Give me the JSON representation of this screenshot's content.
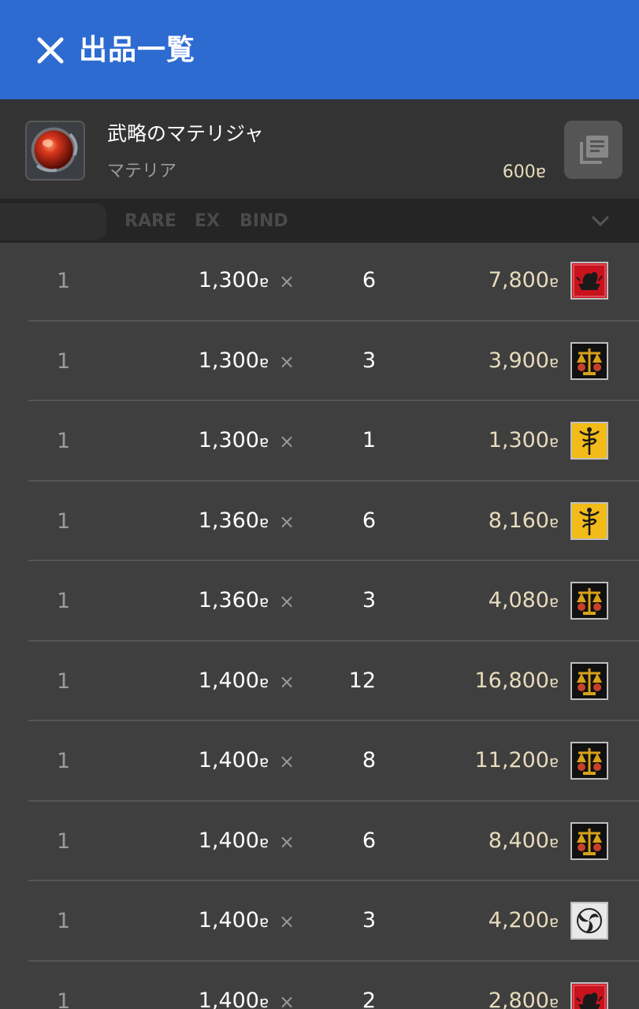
{
  "header": {
    "title": "出品一覧"
  },
  "item": {
    "name": "武略のマテリジャ",
    "category": "マテリア",
    "price": "600ɐ"
  },
  "filters": {
    "rare": "RARE",
    "ex": "EX",
    "bind": "BIND"
  },
  "listings": [
    {
      "hq": "1",
      "unit_price": "1,300",
      "times": "×",
      "quantity": "6",
      "total": "7,800",
      "currency": "ɐ",
      "retainer_icon": "red-bird-crest-icon"
    },
    {
      "hq": "1",
      "unit_price": "1,300",
      "times": "×",
      "quantity": "3",
      "total": "3,900",
      "currency": "ɐ",
      "retainer_icon": "gold-scales-crest-icon"
    },
    {
      "hq": "1",
      "unit_price": "1,300",
      "times": "×",
      "quantity": "1",
      "total": "1,300",
      "currency": "ɐ",
      "retainer_icon": "yellow-caduceus-crest-icon"
    },
    {
      "hq": "1",
      "unit_price": "1,360",
      "times": "×",
      "quantity": "6",
      "total": "8,160",
      "currency": "ɐ",
      "retainer_icon": "yellow-caduceus-crest-icon"
    },
    {
      "hq": "1",
      "unit_price": "1,360",
      "times": "×",
      "quantity": "3",
      "total": "4,080",
      "currency": "ɐ",
      "retainer_icon": "gold-scales-crest-icon"
    },
    {
      "hq": "1",
      "unit_price": "1,400",
      "times": "×",
      "quantity": "12",
      "total": "16,800",
      "currency": "ɐ",
      "retainer_icon": "gold-scales-crest-icon"
    },
    {
      "hq": "1",
      "unit_price": "1,400",
      "times": "×",
      "quantity": "8",
      "total": "11,200",
      "currency": "ɐ",
      "retainer_icon": "gold-scales-crest-icon"
    },
    {
      "hq": "1",
      "unit_price": "1,400",
      "times": "×",
      "quantity": "6",
      "total": "8,400",
      "currency": "ɐ",
      "retainer_icon": "gold-scales-crest-icon"
    },
    {
      "hq": "1",
      "unit_price": "1,400",
      "times": "×",
      "quantity": "3",
      "total": "4,200",
      "currency": "ɐ",
      "retainer_icon": "white-triskele-crest-icon"
    },
    {
      "hq": "1",
      "unit_price": "1,400",
      "times": "×",
      "quantity": "2",
      "total": "2,800",
      "currency": "ɐ",
      "retainer_icon": "red-bird-crest-icon"
    }
  ],
  "colors": {
    "topbar": "#2d6bd0",
    "background": "#3f3f3f",
    "total_text": "#e7dcbc"
  }
}
